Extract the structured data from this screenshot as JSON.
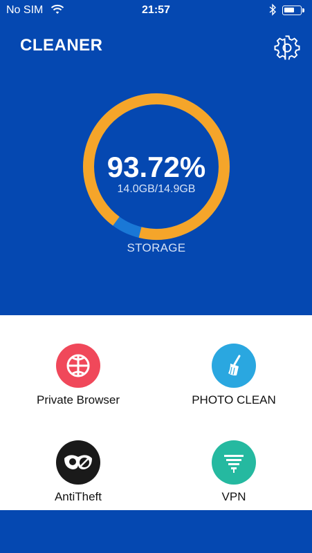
{
  "status_bar": {
    "carrier": "No SIM",
    "time": "21:57",
    "battery_level": 0.65
  },
  "header": {
    "title": "CLEANER",
    "settings_icon": "gear-icon"
  },
  "storage": {
    "percent_text": "93.72%",
    "usage_text": "14.0GB/14.9GB",
    "label": "STORAGE",
    "used_fraction": 0.9372
  },
  "features": [
    {
      "label": "Private Browser",
      "icon": "globe-icon",
      "color": "#f0485a"
    },
    {
      "label": "PHOTO CLEAN",
      "icon": "broom-icon",
      "color": "#2aa7e0"
    },
    {
      "label": "AntiTheft",
      "icon": "mask-icon",
      "color": "#1a1a1a"
    },
    {
      "label": "VPN",
      "icon": "filter-icon",
      "color": "#25b9a0"
    }
  ],
  "colors": {
    "primary_blue": "#0548b1",
    "ring_used": "#f5a52a",
    "ring_free": "#1a78d6"
  }
}
